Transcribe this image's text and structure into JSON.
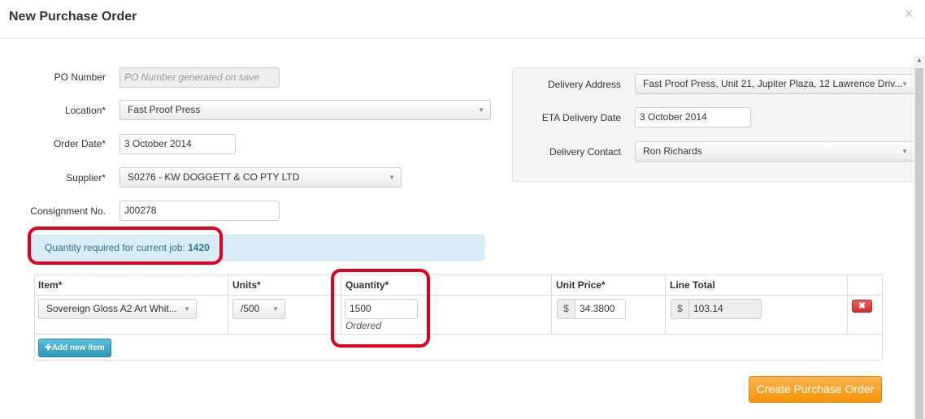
{
  "modal": {
    "title": "New Purchase Order",
    "close_icon": "close-icon"
  },
  "form": {
    "po_number": {
      "label": "PO Number",
      "placeholder": "PO Number generated on save"
    },
    "location": {
      "label": "Location*",
      "value": "Fast Proof Press"
    },
    "order_date": {
      "label": "Order Date*",
      "value": "3 October 2014"
    },
    "supplier": {
      "label": "Supplier*",
      "value": "S0276 - KW DOGGETT & CO PTY LTD"
    },
    "consignment": {
      "label": "Consignment No.",
      "value": "J00278"
    }
  },
  "delivery": {
    "address": {
      "label": "Delivery Address",
      "value": "Fast Proof Press, Unit 21, Jupiter Plaza, 12 Lawrence Driv..."
    },
    "eta": {
      "label": "ETA Delivery Date",
      "value": "3 October 2014"
    },
    "contact": {
      "label": "Delivery Contact",
      "value": "Ron Richards"
    }
  },
  "alert": {
    "text": "Quantity required for current job: ",
    "quantity": "1420"
  },
  "table": {
    "headers": {
      "item": "Item*",
      "units": "Units*",
      "quantity": "Quantity*",
      "unit_price": "Unit Price*",
      "line_total": "Line Total"
    },
    "rows": [
      {
        "item": "Sovereign Gloss A2 Art Whit...",
        "units": "/500",
        "quantity": "1500",
        "quantity_note": "Ordered",
        "currency": "$",
        "unit_price": "34.3800",
        "line_total": "103.14"
      }
    ]
  },
  "buttons": {
    "delete_symbol": "✖",
    "add_item": "Add new item",
    "add_symbol": "✚",
    "create": "Create Purchase Order"
  },
  "colors": {
    "highlight_ring": "#e0001b",
    "info_bg": "#d9edf7",
    "create_button": "#f89406",
    "add_button": "#2f96b4",
    "delete_button": "#c9302c"
  }
}
